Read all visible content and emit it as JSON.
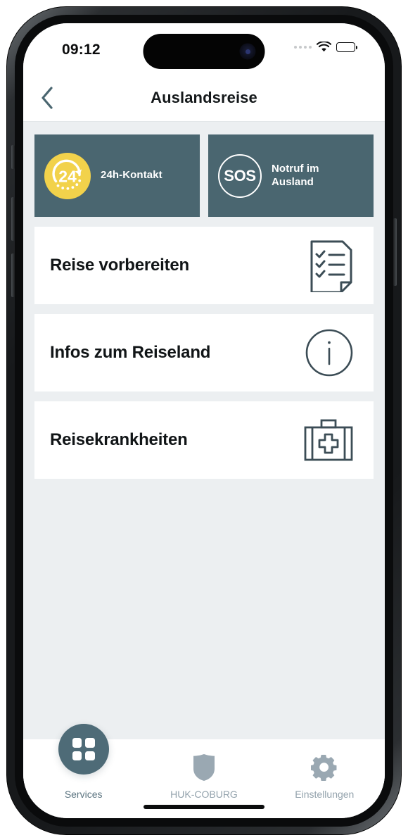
{
  "status_bar": {
    "time": "09:12",
    "signal_icon": "signal-dots-icon",
    "wifi_icon": "wifi-icon",
    "battery_icon": "battery-full-icon"
  },
  "header": {
    "back_icon": "chevron-left-icon",
    "title": "Auslandsreise"
  },
  "tiles": [
    {
      "label": "24h-Kontakt",
      "icon": "clock-24h-icon",
      "icon_color": "#f2d24b",
      "bg_color": "#4a6670"
    },
    {
      "label_line1": "Notruf im",
      "label_line2": "Ausland",
      "icon": "sos-circle-icon",
      "icon_text": "SOS",
      "bg_color": "#4a6670"
    }
  ],
  "cards": [
    {
      "title": "Reise vorbereiten",
      "icon": "checklist-document-icon"
    },
    {
      "title": "Infos zum Reiseland",
      "icon": "info-circle-icon"
    },
    {
      "title": "Reisekrankheiten",
      "icon": "first-aid-kit-icon"
    }
  ],
  "tab_bar": {
    "items": [
      {
        "label": "Services",
        "icon": "grid-squares-icon",
        "active": true
      },
      {
        "label": "HUK-COBURG",
        "icon": "shield-icon",
        "active": false
      },
      {
        "label": "Einstellungen",
        "icon": "gear-icon",
        "active": false
      }
    ]
  },
  "colors": {
    "accent_slate": "#4a6670",
    "accent_yellow": "#f2d24b",
    "page_bg": "#eceff1",
    "icon_stroke": "#3c4d56",
    "tab_inactive": "#93a2ac"
  }
}
